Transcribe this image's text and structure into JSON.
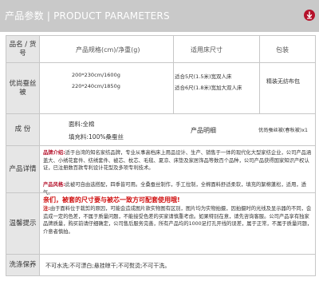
{
  "header": {
    "title": "产品参数 | PRODUCT PARAMETERS",
    "accent_color": "#b5122b",
    "icon": "download-arrow-icon"
  },
  "table": {
    "columns": {
      "label": "品名 / 货号",
      "spec": "产品规格(cm)/净重(g)",
      "bed": "适用床尺寸",
      "pack": "包装"
    },
    "product_row": {
      "label": "优尚蚕丝被",
      "specs": [
        "200*230cm/1600g",
        "220*240cm/1850g"
      ],
      "beds": [
        "适合5尺(1.5米)宽双人床",
        "适合6尺(1.8米)宽加大双人床"
      ],
      "pack": "精装无纺布包"
    },
    "material_row": {
      "label": "成 份",
      "fabric": "面料:全棉",
      "filling": "填充料:100%桑蚕丝",
      "detail_label": "产品明细",
      "detail_value": "优尚蚕丝被(春秋被)x1"
    },
    "details_row": {
      "label": "产品详情",
      "brand_intro_label": "品牌介绍:",
      "brand_intro": "适于台湾的知名家纺品牌，专业从事高档床上用品设计、生产、销售于一体的现代化大型家纺企业，公司产品涵盖大、小绣花套件、纺绣套件、被芯、枕芯、毛毯、夏凉、床垫及家居饰品等数百个品种，公司产品获得国家知识产权认证，已注册数百款专利设计花型及多项专利技术。",
      "style_label": "产品风格:",
      "style": "此被可自由选搭配，四季皆可用。全桑蚕丝制作，手工拉制，全棉面料舒适柔软，填充的絮棉蓬松，适用，透气。"
    },
    "notice_row": {
      "label": "温馨提示",
      "headline": "亲们，被套的尺寸要与被芯一致方可配套使用哦!",
      "note_label": "注:",
      "note": "由于面料位于栽剪的原因，可能会造成图片款实物图有区别，图片均为实物拍摄，因拍摄时的光线及显示器的不同，会造成一定的色差，不属于质量问题，不能接受色差的买家请慎重考虑。如果特别在意，请先咨询客服。公司产品享有独家品牌质量，购买前请仔细确定，公司售后服务完善，所有产品均",
      "note_tail": "的1000足打孔开线的误差，属于正常，不属于质量问题，介意者慎拍。"
    },
    "care_row": {
      "label": "洗涤保养",
      "text": "不可水洗;不可漂白;悬挂晾干;不可熨烫;不可干洗。"
    }
  }
}
